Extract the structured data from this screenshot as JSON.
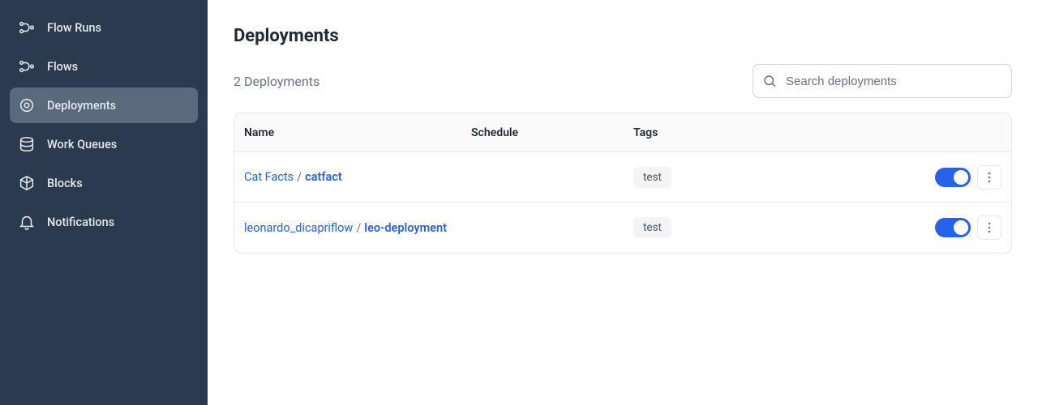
{
  "sidebar": {
    "items": [
      {
        "label": "Flow Runs",
        "icon": "flow-runs-icon",
        "active": false
      },
      {
        "label": "Flows",
        "icon": "flows-icon",
        "active": false
      },
      {
        "label": "Deployments",
        "icon": "deployments-icon",
        "active": true
      },
      {
        "label": "Work Queues",
        "icon": "work-queues-icon",
        "active": false
      },
      {
        "label": "Blocks",
        "icon": "blocks-icon",
        "active": false
      },
      {
        "label": "Notifications",
        "icon": "notifications-icon",
        "active": false
      }
    ]
  },
  "header": {
    "title": "Deployments",
    "count_text": "2 Deployments"
  },
  "search": {
    "placeholder": "Search deployments"
  },
  "table": {
    "columns": {
      "name": "Name",
      "schedule": "Schedule",
      "tags": "Tags"
    },
    "rows": [
      {
        "flow": "Cat Facts",
        "deployment": "catfact",
        "schedule": "",
        "tag": "test",
        "enabled": true
      },
      {
        "flow": "leonardo_dicapriflow",
        "deployment": "leo-deployment",
        "schedule": "",
        "tag": "test",
        "enabled": true
      }
    ]
  },
  "colors": {
    "sidebar_bg": "#2C3A4F",
    "sidebar_active": "#5A697C",
    "link": "#2563eb",
    "toggle_on": "#2563eb"
  }
}
